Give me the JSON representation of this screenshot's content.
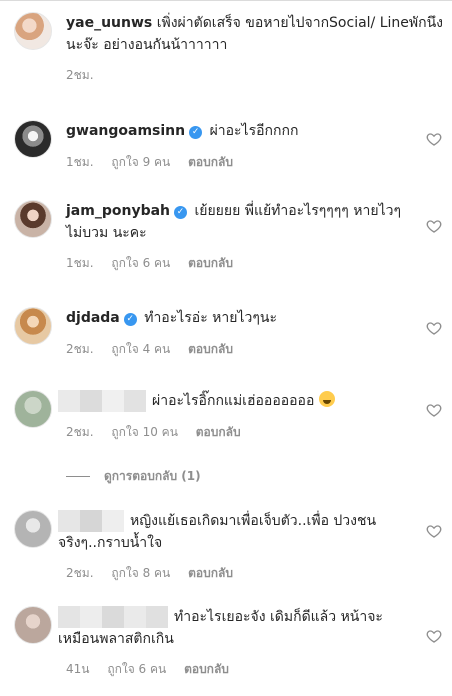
{
  "caption": {
    "username": "yae_uunws",
    "text": "เพิ่งผ่าตัดเสร็จ ขอหายไปจากSocial/ Lineพักนึงนะจ๊ะ อย่างอนกันน้าาาาาา",
    "time": "2ชม."
  },
  "comments": [
    {
      "username": "gwangoamsinn",
      "verified": true,
      "text": "ผ่าอะไรอีกกกก",
      "time": "1ชม.",
      "likes": "ถูกใจ 9 คน",
      "reply": "ตอบกลับ"
    },
    {
      "username": "jam_ponybah",
      "verified": true,
      "text": "เย้ยยยย พี่แย้ทำอะไรๆๆๆๆ หายไวๆ ไม่บวม นะคะ",
      "time": "1ชม.",
      "likes": "ถูกใจ 6 คน",
      "reply": "ตอบกลับ"
    },
    {
      "username": "djdada",
      "verified": true,
      "text": "ทำอะไรอ่ะ หายไวๆนะ",
      "time": "2ชม.",
      "likes": "ถูกใจ 4 คน",
      "reply": "ตอบกลับ"
    },
    {
      "username": "",
      "verified": false,
      "text": "ผ่าอะไรอิ๊กกแม่เฮ่อออออออ",
      "emoji": "face-with-tears-of-joy",
      "time": "2ชม.",
      "likes": "ถูกใจ 10 คน",
      "reply": "ตอบกลับ",
      "view_replies": "ดูการตอบกลับ (1)"
    },
    {
      "username": "",
      "verified": false,
      "text": "หญิงแย้เธอเกิดมาเพื่อเจ็บตัว..เพื่อ ปวงชนจริงๆ..กราบน้ำใจ",
      "time": "2ชม.",
      "likes": "ถูกใจ 8 คน",
      "reply": "ตอบกลับ"
    },
    {
      "username": "",
      "verified": false,
      "text": "ทำอะไรเยอะจัง เดิมก็ดีแล้ว หน้าจะเหมือนพลาสติกเกิน",
      "time": "41น",
      "likes": "ถูกใจ 6 คน",
      "reply": "ตอบกลับ"
    }
  ],
  "icons": {
    "verified": "verified-badge-icon",
    "like": "heart-outline-icon",
    "verified_color": "#3897f0",
    "muted_color": "#8e8e8e"
  }
}
